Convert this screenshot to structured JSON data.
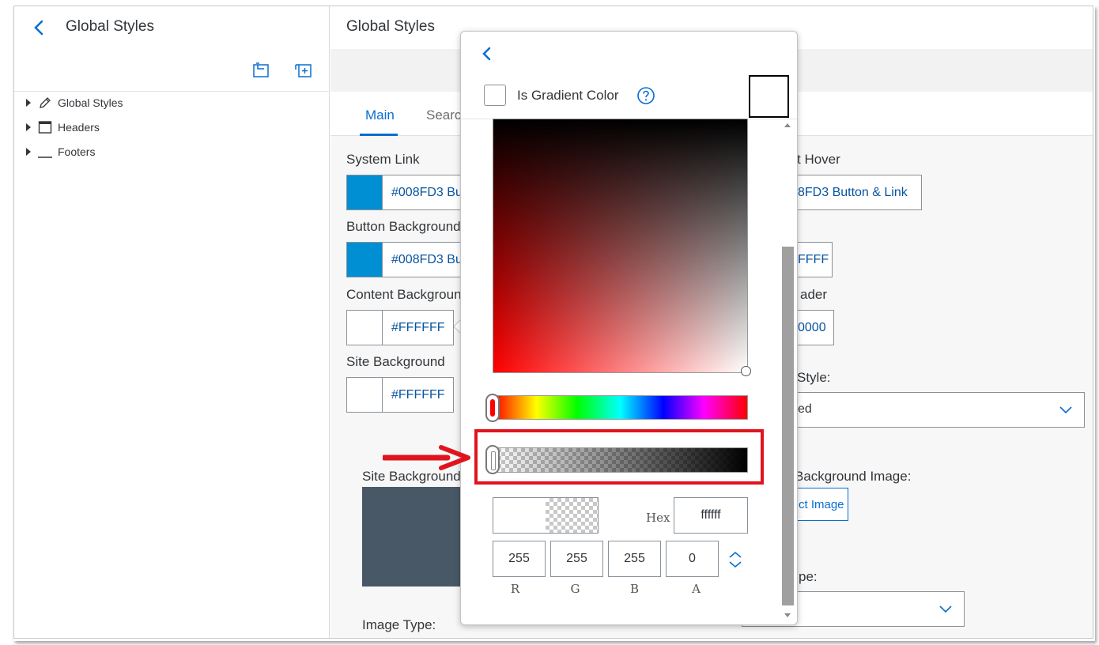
{
  "left_panel": {
    "title": "Global Styles",
    "tree": [
      {
        "label": "Global Styles",
        "icon": "pencil-icon"
      },
      {
        "label": "Headers",
        "icon": "header-window-icon"
      },
      {
        "label": "Footers",
        "icon": "footer-line-icon"
      }
    ]
  },
  "right_panel": {
    "title": "Global Styles",
    "tabs": [
      {
        "label": "Main",
        "active": true
      },
      {
        "label": "Searc",
        "active": false
      }
    ],
    "fields": {
      "system_link": {
        "label": "System Link",
        "swatch": "#008FD3",
        "value": "#008FD3 Bu"
      },
      "button_background": {
        "label": "Button Background",
        "swatch": "#008FD3",
        "value": "#008FD3 Bu"
      },
      "content_background": {
        "label": "Content Backgroun",
        "swatch": "#FFFFFF",
        "value": "#FFFFFF"
      },
      "site_background": {
        "label": "Site Background",
        "swatch": "#FFFFFF",
        "value": "#FFFFFF"
      },
      "site_background_preview_label": "Site Background",
      "image_type_label": "Image Type:"
    },
    "right_column": {
      "hover_label": "t Hover",
      "hover_value": "8FD3 Button & Link",
      "ffff_value": "FFFF",
      "header_label": "ader",
      "header_value": "0000",
      "style_label": "Style:",
      "style_value": "ed",
      "bg_image_label": "Background Image:",
      "select_image_label": "ct Image",
      "type_label": "pe:"
    }
  },
  "color_picker": {
    "gradient_label": "Is Gradient Color",
    "gradient_checked": false,
    "preview_color": "#ffffff",
    "hue_color": "#ff0000",
    "hex_label": "Hex",
    "hex_value": "ffffff",
    "r": "255",
    "g": "255",
    "b": "255",
    "a": "0",
    "r_label": "R",
    "g_label": "G",
    "b_label": "B",
    "a_label": "A"
  },
  "colors": {
    "accent": "#0a6ed1",
    "link_text": "#0854a0",
    "annotation": "#e0141e",
    "preview_tile": "#485866"
  }
}
